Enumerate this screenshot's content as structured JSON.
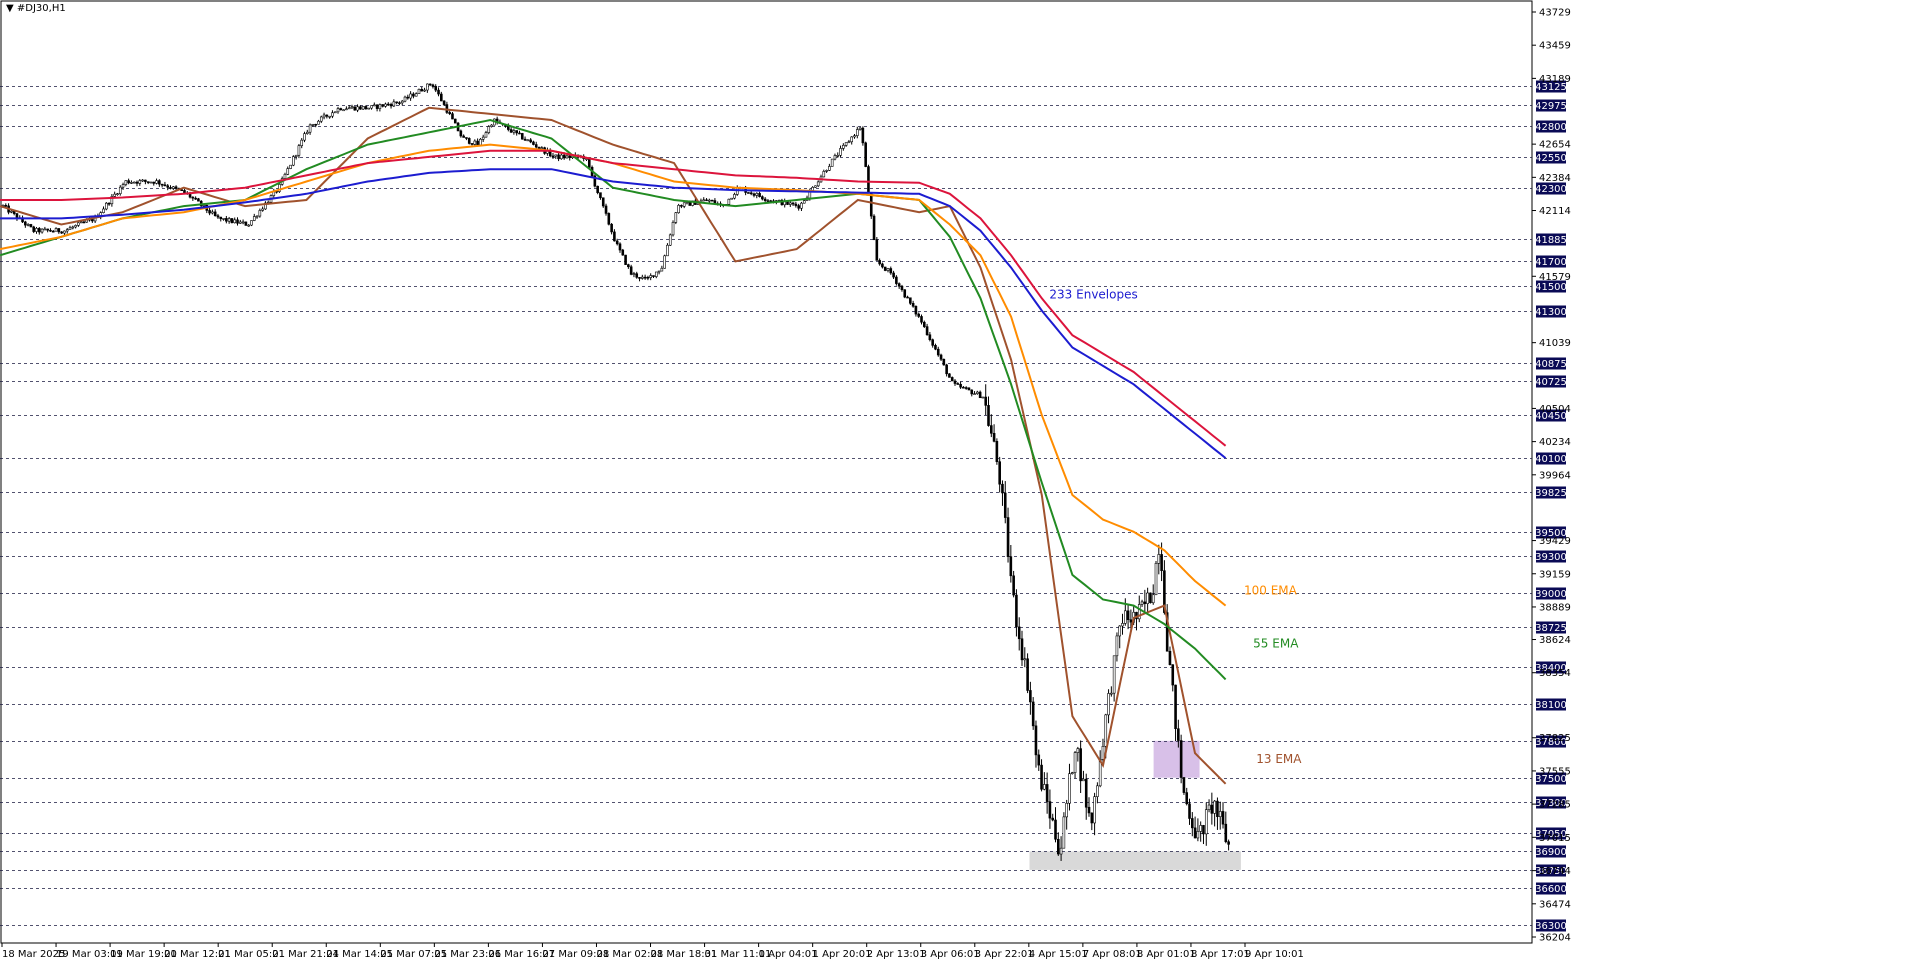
{
  "chart_data": {
    "type": "candlestick",
    "symbol_title": "#DJ30,H1",
    "y_axis": {
      "range": [
        36204,
        43729
      ],
      "ticks": [
        43729,
        43459,
        43189,
        42654,
        42384,
        42114,
        41579,
        41039,
        40504,
        40234,
        39964,
        39429,
        39159,
        38889,
        38624,
        38354,
        37825,
        37555,
        37285,
        37015,
        36744,
        36474,
        36204
      ]
    },
    "x_axis": {
      "tick_labels": [
        "18 Mar 2025",
        "19 Mar 03:01",
        "19 Mar 19:01",
        "20 Mar 12:01",
        "21 Mar 05:01",
        "21 Mar 21:01",
        "24 Mar 14:01",
        "25 Mar 07:01",
        "25 Mar 23:01",
        "26 Mar 16:01",
        "27 Mar 09:01",
        "28 Mar 02:01",
        "28 Mar 18:01",
        "31 Mar 11:01",
        "1 Apr 04:01",
        "1 Apr 20:01",
        "2 Apr 13:01",
        "3 Apr 06:01",
        "3 Apr 22:01",
        "4 Apr 15:01",
        "7 Apr 08:01",
        "8 Apr 01:01",
        "8 Apr 17:01",
        "9 Apr 10:01"
      ]
    },
    "horizontal_levels": [
      43125,
      42975,
      42800,
      42550,
      42300,
      41885,
      41700,
      41500,
      41300,
      40875,
      40725,
      40450,
      40100,
      39825,
      39500,
      39300,
      39000,
      38725,
      38400,
      38100,
      37800,
      37500,
      37300,
      37050,
      36900,
      36750,
      36600,
      36300
    ],
    "series": [
      {
        "name": "13 EMA",
        "color": "#a0522d",
        "x": [
          0,
          0.04,
          0.08,
          0.12,
          0.16,
          0.2,
          0.24,
          0.28,
          0.32,
          0.36,
          0.4,
          0.44,
          0.48,
          0.52,
          0.56,
          0.6,
          0.62,
          0.64,
          0.66,
          0.68,
          0.7,
          0.72,
          0.74,
          0.76,
          0.78,
          0.8
        ],
        "values": [
          42150,
          42000,
          42100,
          42300,
          42150,
          42200,
          42700,
          42950,
          42900,
          42850,
          42650,
          42500,
          41700,
          41800,
          42200,
          42100,
          42150,
          41650,
          40900,
          39800,
          38000,
          37600,
          38800,
          38900,
          37700,
          37450
        ]
      },
      {
        "name": "55 EMA",
        "color": "#228b22",
        "x": [
          0,
          0.04,
          0.08,
          0.12,
          0.16,
          0.2,
          0.24,
          0.28,
          0.32,
          0.36,
          0.4,
          0.44,
          0.48,
          0.52,
          0.56,
          0.6,
          0.62,
          0.64,
          0.66,
          0.68,
          0.7,
          0.72,
          0.74,
          0.76,
          0.78,
          0.8
        ],
        "values": [
          41750,
          41900,
          42050,
          42150,
          42200,
          42450,
          42650,
          42750,
          42850,
          42700,
          42300,
          42200,
          42150,
          42200,
          42250,
          42200,
          41900,
          41400,
          40700,
          39900,
          39150,
          38950,
          38900,
          38750,
          38550,
          38300
        ]
      },
      {
        "name": "100 EMA",
        "color": "#ff8c00",
        "x": [
          0,
          0.04,
          0.08,
          0.12,
          0.16,
          0.2,
          0.24,
          0.28,
          0.32,
          0.36,
          0.4,
          0.44,
          0.48,
          0.52,
          0.56,
          0.6,
          0.62,
          0.64,
          0.66,
          0.68,
          0.7,
          0.72,
          0.74,
          0.76,
          0.78,
          0.8
        ],
        "values": [
          41800,
          41900,
          42050,
          42100,
          42200,
          42350,
          42500,
          42600,
          42650,
          42600,
          42500,
          42350,
          42300,
          42280,
          42250,
          42200,
          42000,
          41750,
          41250,
          40450,
          39800,
          39600,
          39500,
          39350,
          39100,
          38900
        ]
      },
      {
        "name": "233 Envelopes",
        "color": "#dc143c",
        "x": [
          0,
          0.04,
          0.08,
          0.12,
          0.16,
          0.2,
          0.24,
          0.28,
          0.32,
          0.36,
          0.4,
          0.44,
          0.48,
          0.52,
          0.56,
          0.6,
          0.62,
          0.64,
          0.66,
          0.68,
          0.7,
          0.72,
          0.74,
          0.76,
          0.78,
          0.8
        ],
        "values": [
          42200,
          42200,
          42220,
          42250,
          42300,
          42400,
          42500,
          42550,
          42600,
          42600,
          42500,
          42450,
          42400,
          42380,
          42350,
          42340,
          42250,
          42050,
          41750,
          41400,
          41100,
          40950,
          40800,
          40600,
          40400,
          40200
        ]
      },
      {
        "name": "233 Envelopes lower",
        "color": "#1c1cd0",
        "x": [
          0,
          0.04,
          0.08,
          0.12,
          0.16,
          0.2,
          0.24,
          0.28,
          0.32,
          0.36,
          0.4,
          0.44,
          0.48,
          0.52,
          0.56,
          0.6,
          0.62,
          0.64,
          0.66,
          0.68,
          0.7,
          0.72,
          0.74,
          0.76,
          0.78,
          0.8
        ],
        "values": [
          42050,
          42050,
          42080,
          42120,
          42180,
          42250,
          42350,
          42420,
          42450,
          42450,
          42350,
          42300,
          42280,
          42270,
          42260,
          42250,
          42150,
          41950,
          41650,
          41300,
          41000,
          40850,
          40700,
          40500,
          40300,
          40100
        ]
      }
    ],
    "annotations": [
      {
        "text": "233 Envelopes",
        "color": "#1c1cd0",
        "x": 0.685,
        "value": 41400
      },
      {
        "text": "100 EMA",
        "color": "#ff8c00",
        "x": 0.812,
        "value": 38990
      },
      {
        "text": "55 EMA",
        "color": "#228b22",
        "x": 0.818,
        "value": 38560
      },
      {
        "text": "13 EMA",
        "color": "#a0522d",
        "x": 0.82,
        "value": 37620
      }
    ],
    "zones": [
      {
        "color": "#d8c0e8",
        "x0": 0.753,
        "x1": 0.783,
        "v0": 37500,
        "v1": 37800
      },
      {
        "color": "#d9d9d9",
        "x0": 0.672,
        "x1": 0.81,
        "v0": 36750,
        "v1": 36900
      }
    ],
    "price_path": {
      "x": [
        0,
        0.02,
        0.04,
        0.06,
        0.08,
        0.1,
        0.12,
        0.14,
        0.16,
        0.18,
        0.2,
        0.22,
        0.24,
        0.26,
        0.28,
        0.3,
        0.31,
        0.32,
        0.34,
        0.36,
        0.38,
        0.4,
        0.41,
        0.42,
        0.43,
        0.44,
        0.46,
        0.47,
        0.48,
        0.5,
        0.52,
        0.54,
        0.56,
        0.57,
        0.58,
        0.6,
        0.62,
        0.64,
        0.65,
        0.66,
        0.67,
        0.675,
        0.69,
        0.7,
        0.71,
        0.72,
        0.73,
        0.74,
        0.75,
        0.755,
        0.76,
        0.77,
        0.78,
        0.79,
        0.8
      ],
      "values": [
        42150,
        41950,
        41950,
        42050,
        42350,
        42350,
        42250,
        42050,
        42000,
        42300,
        42800,
        42950,
        42950,
        43000,
        43150,
        42700,
        42650,
        42850,
        42700,
        42550,
        42550,
        41850,
        41600,
        41550,
        41650,
        42150,
        42200,
        42150,
        42300,
        42200,
        42150,
        42500,
        42800,
        41700,
        41600,
        41200,
        40700,
        40600,
        40000,
        38900,
        38200,
        37600,
        36900,
        37800,
        37100,
        38000,
        38800,
        38800,
        39000,
        39450,
        38600,
        37400,
        37000,
        37300,
        36950
      ]
    },
    "chart_area": {
      "x_start": 0,
      "x_end": 0.8
    }
  }
}
